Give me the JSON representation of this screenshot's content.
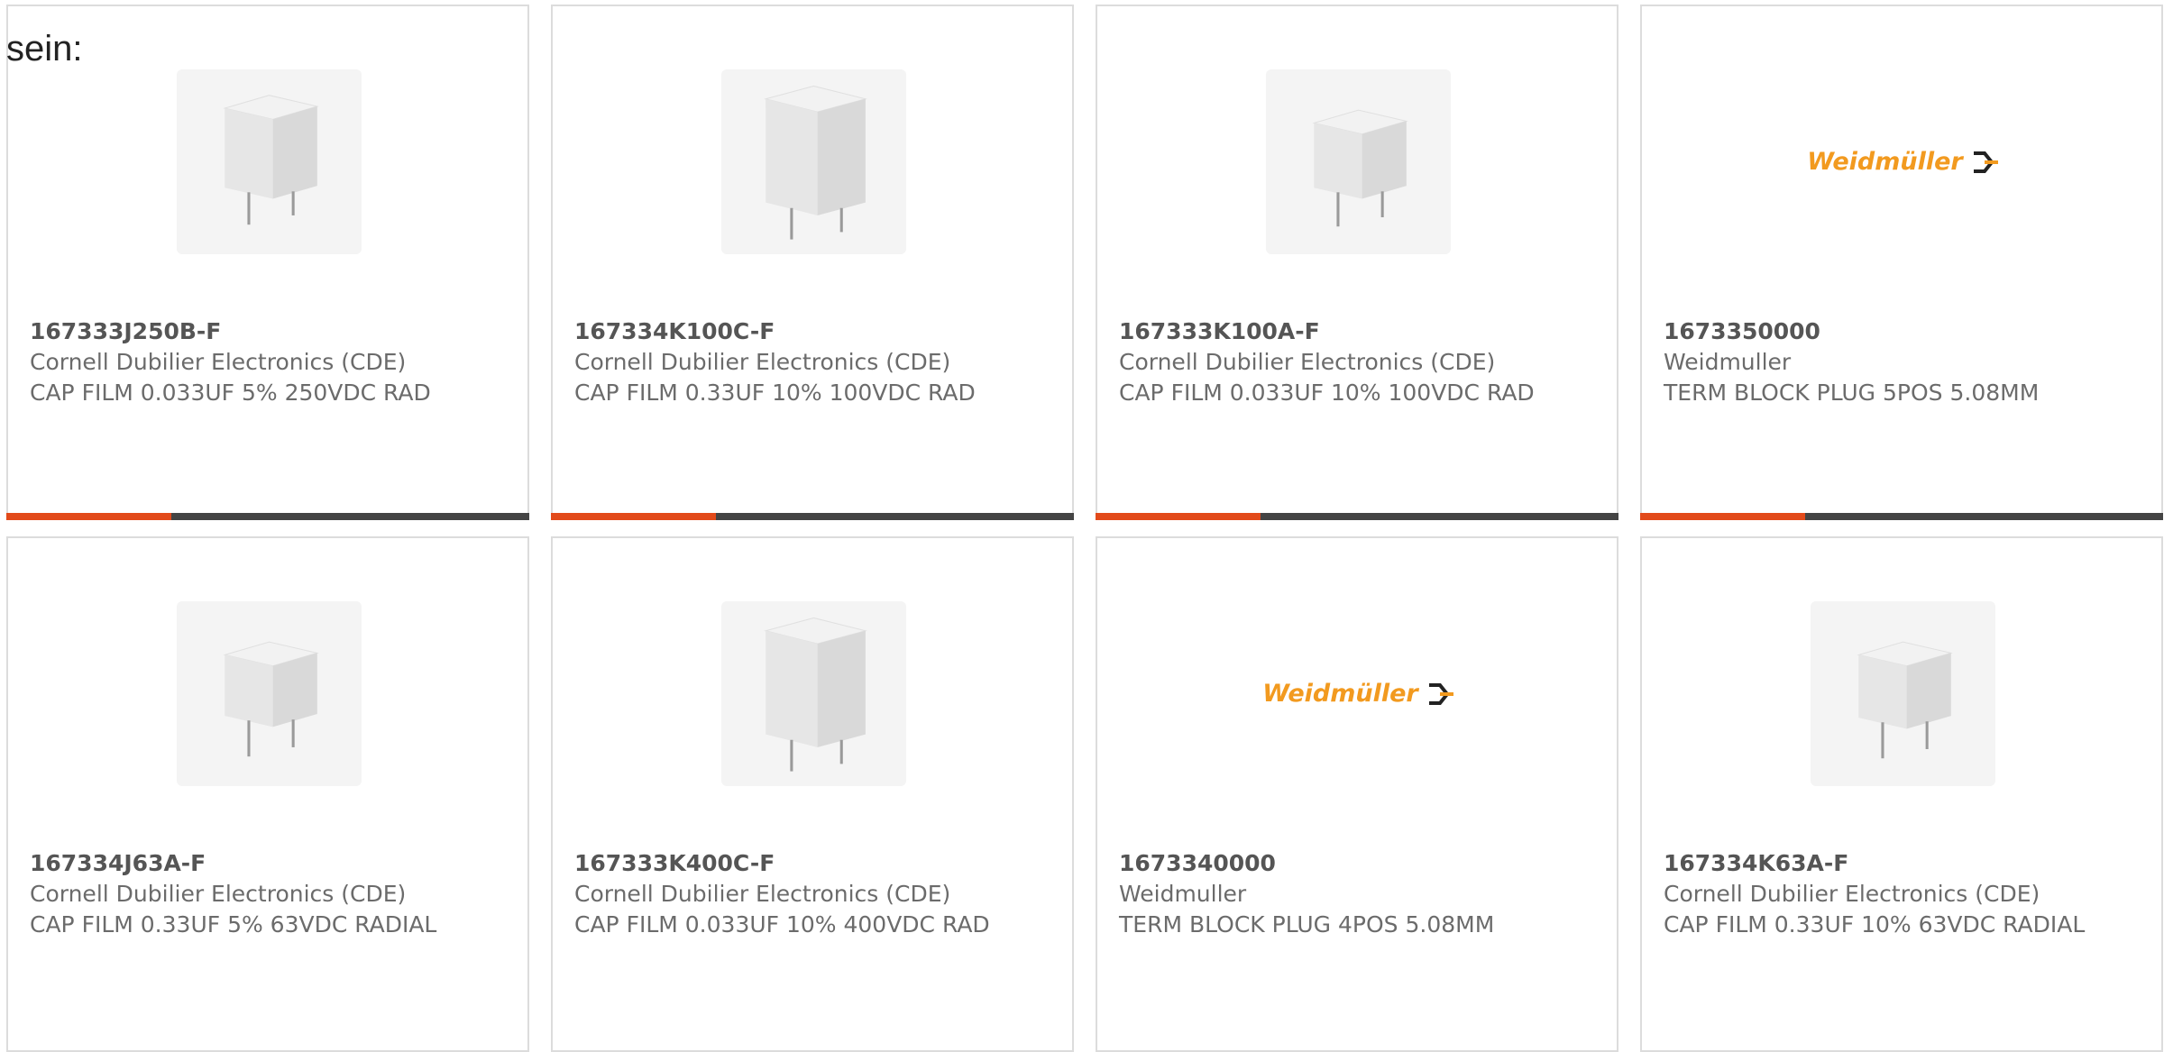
{
  "intro_text": "sein:",
  "colors": {
    "accent": "#e24a1a",
    "bar": "#444444",
    "text": "#6b6b6b",
    "logo": "#f29a1f"
  },
  "products": [
    {
      "part_number": "167333J250B-F",
      "manufacturer": "Cornell Dubilier Electronics (CDE)",
      "description": "CAP FILM 0.033UF 5% 250VDC RAD",
      "image": "film-capacitor-image"
    },
    {
      "part_number": "167334K100C-F",
      "manufacturer": "Cornell Dubilier Electronics (CDE)",
      "description": "CAP FILM 0.33UF 10% 100VDC RAD",
      "image": "film-capacitor-image"
    },
    {
      "part_number": "167333K100A-F",
      "manufacturer": "Cornell Dubilier Electronics (CDE)",
      "description": "CAP FILM 0.033UF 10% 100VDC RAD",
      "image": "film-capacitor-image"
    },
    {
      "part_number": "1673350000",
      "manufacturer": "Weidmuller",
      "description": "TERM BLOCK PLUG 5POS 5.08MM",
      "image": "weidmuller-logo",
      "logo_text": "Weidmüller"
    },
    {
      "part_number": "167334J63A-F",
      "manufacturer": "Cornell Dubilier Electronics (CDE)",
      "description": "CAP FILM 0.33UF 5% 63VDC RADIAL",
      "image": "film-capacitor-image"
    },
    {
      "part_number": "167333K400C-F",
      "manufacturer": "Cornell Dubilier Electronics (CDE)",
      "description": "CAP FILM 0.033UF 10% 400VDC RAD",
      "image": "film-capacitor-image"
    },
    {
      "part_number": "1673340000",
      "manufacturer": "Weidmuller",
      "description": "TERM BLOCK PLUG 4POS 5.08MM",
      "image": "weidmuller-logo",
      "logo_text": "Weidmüller"
    },
    {
      "part_number": "167334K63A-F",
      "manufacturer": "Cornell Dubilier Electronics (CDE)",
      "description": "CAP FILM 0.33UF 10% 63VDC RADIAL",
      "image": "film-capacitor-image"
    }
  ]
}
